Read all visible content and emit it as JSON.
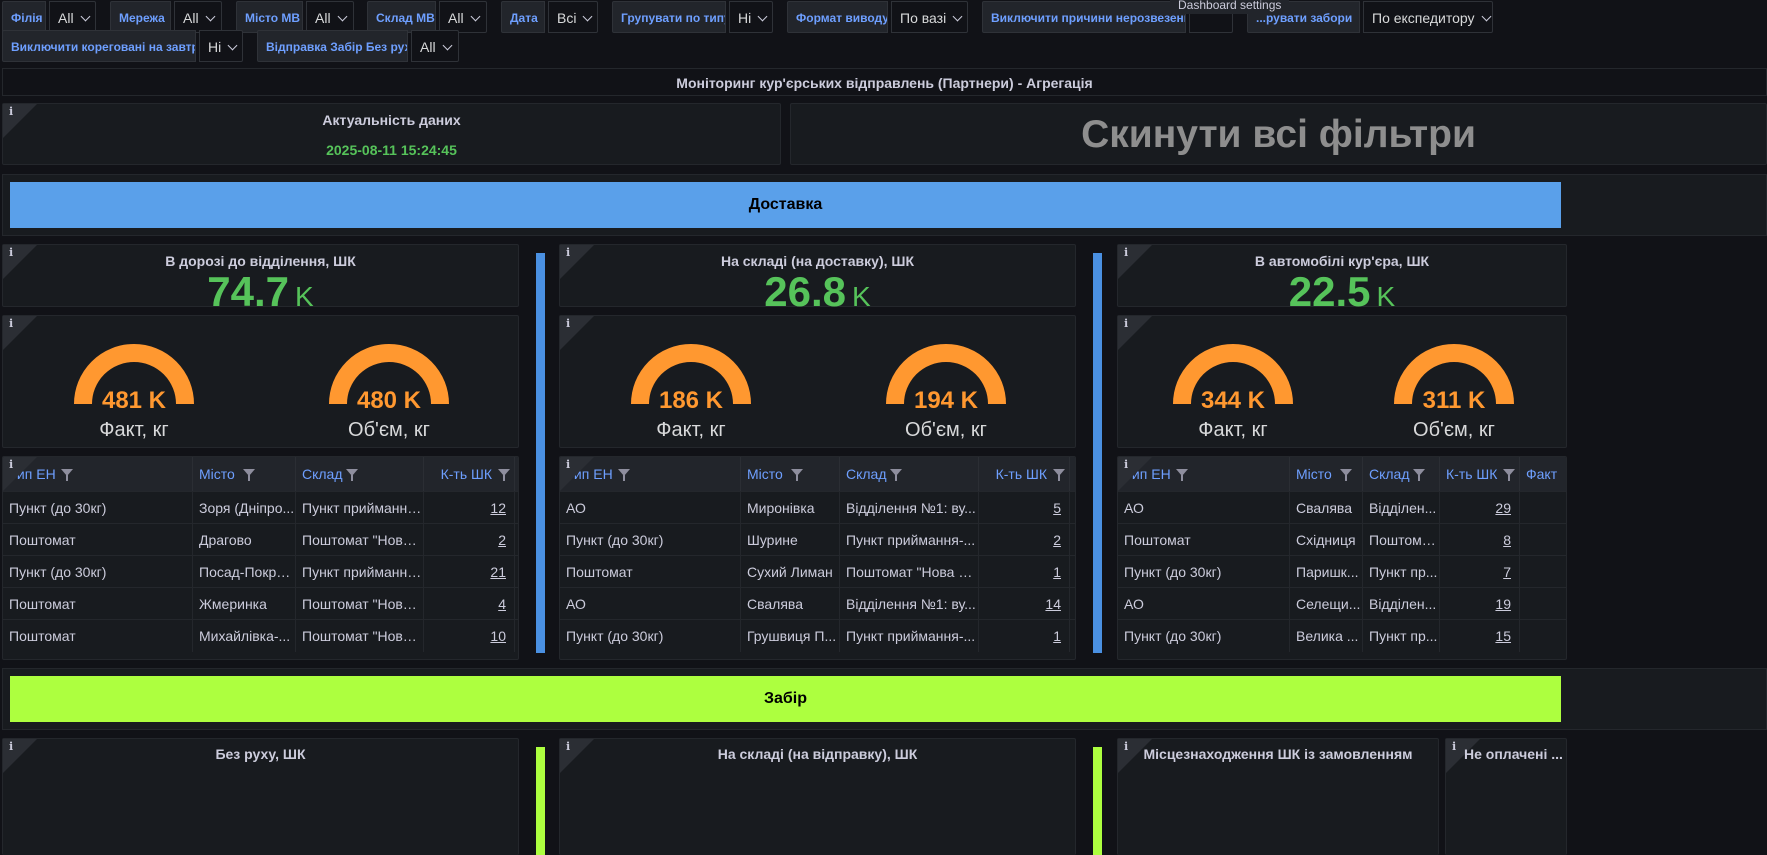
{
  "filters": [
    {
      "label": "Філія",
      "value": "All"
    },
    {
      "label": "Мережа",
      "value": "All"
    },
    {
      "label": "Місто МВ",
      "value": "All"
    },
    {
      "label": "Склад МВ",
      "value": "All"
    },
    {
      "label": "Дата",
      "value": "Всі"
    },
    {
      "label": "Групувати по типу",
      "value": "Ні"
    },
    {
      "label": "Формат виводу",
      "value": "По вазі"
    },
    {
      "label": "Виключити причини нерозвезення",
      "value": ""
    },
    {
      "label": "...рувати забори",
      "value": "По експедитору"
    },
    {
      "label": "Виключити кореговані на завтра",
      "value": "Ні"
    },
    {
      "label": "Відправка Забір Без руху",
      "value": "All"
    }
  ],
  "tooltip": "Dashboard settings",
  "section_title": "Моніторинг кур'єрських відправлень (Партнери) - Агрегація",
  "freshness": {
    "title": "Актуальність даних",
    "value": "2025-08-11 15:24:45"
  },
  "reset_button": "Скинути всі фільтри",
  "delivery_banner": "Доставка",
  "pickup_banner": "Забір",
  "colors": {
    "delivery": "#5aa0ea",
    "pickup": "#adff3f",
    "stat": "#56c35a",
    "gauge": "#ff9830"
  },
  "columns": [
    {
      "stat_title": "В дорозі до відділення, ШК",
      "stat_value": "74.7",
      "stat_unit": "K",
      "gauges": [
        {
          "value": "481 K",
          "label": "Факт, кг"
        },
        {
          "value": "480 K",
          "label": "Об'єм, кг"
        }
      ],
      "headers": [
        "Тип ЕН",
        "Місто",
        "Склад",
        "К-ть ШК"
      ],
      "rows": [
        [
          "Пункт (до 30кг)",
          "Зоря (Дніпро...",
          "Пункт приймання...",
          "12"
        ],
        [
          "Поштомат",
          "Драгово",
          "Поштомат \"Нова ...",
          "2"
        ],
        [
          "Пункт (до 30кг)",
          "Посад-Покро...",
          "Пункт приймання...",
          "21"
        ],
        [
          "Поштомат",
          "Жмеринка",
          "Поштомат \"Нова ...",
          "4"
        ],
        [
          "Поштомат",
          "Михайлівка-...",
          "Поштомат \"Нова ...",
          "10"
        ]
      ]
    },
    {
      "stat_title": "На складі (на доставку), ШК",
      "stat_value": "26.8",
      "stat_unit": "K",
      "gauges": [
        {
          "value": "186 K",
          "label": "Факт, кг"
        },
        {
          "value": "194 K",
          "label": "Об'єм, кг"
        }
      ],
      "headers": [
        "Тип ЕН",
        "Місто",
        "Склад",
        "К-ть ШК"
      ],
      "rows": [
        [
          "АО",
          "Миронівка",
          "Відділення №1: ву...",
          "5"
        ],
        [
          "Пункт (до 30кг)",
          "Шурине",
          "Пункт приймання-...",
          "2"
        ],
        [
          "Поштомат",
          "Сухий Лиман",
          "Поштомат \"Нова П...",
          "1"
        ],
        [
          "АО",
          "Свалява",
          "Відділення №1: ву...",
          "14"
        ],
        [
          "Пункт (до 30кг)",
          "Грушвиця П...",
          "Пункт приймання-...",
          "1"
        ]
      ]
    },
    {
      "stat_title": "В автомобілі кур'єра, ШК",
      "stat_value": "22.5",
      "stat_unit": "K",
      "gauges": [
        {
          "value": "344 K",
          "label": "Факт, кг"
        },
        {
          "value": "311 K",
          "label": "Об'єм, кг"
        }
      ],
      "headers": [
        "Тип ЕН",
        "Місто",
        "Склад",
        "К-ть ШК",
        "Факт"
      ],
      "rows": [
        [
          "АО",
          "Свалява",
          "Відділен...",
          "29"
        ],
        [
          "Поштомат",
          "Східниця",
          "Поштома...",
          "8"
        ],
        [
          "Пункт (до 30кг)",
          "Паришк...",
          "Пункт пр...",
          "7"
        ],
        [
          "АО",
          "Селещи...",
          "Відділен...",
          "19"
        ],
        [
          "Пункт (до 30кг)",
          "Велика ...",
          "Пункт пр...",
          "15"
        ]
      ]
    }
  ],
  "bottom_titles": [
    "Без руху, ШК",
    "На складі (на відправку), ШК",
    "Місцезнаходження ШК із замовленням",
    "Не оплачені ..."
  ]
}
